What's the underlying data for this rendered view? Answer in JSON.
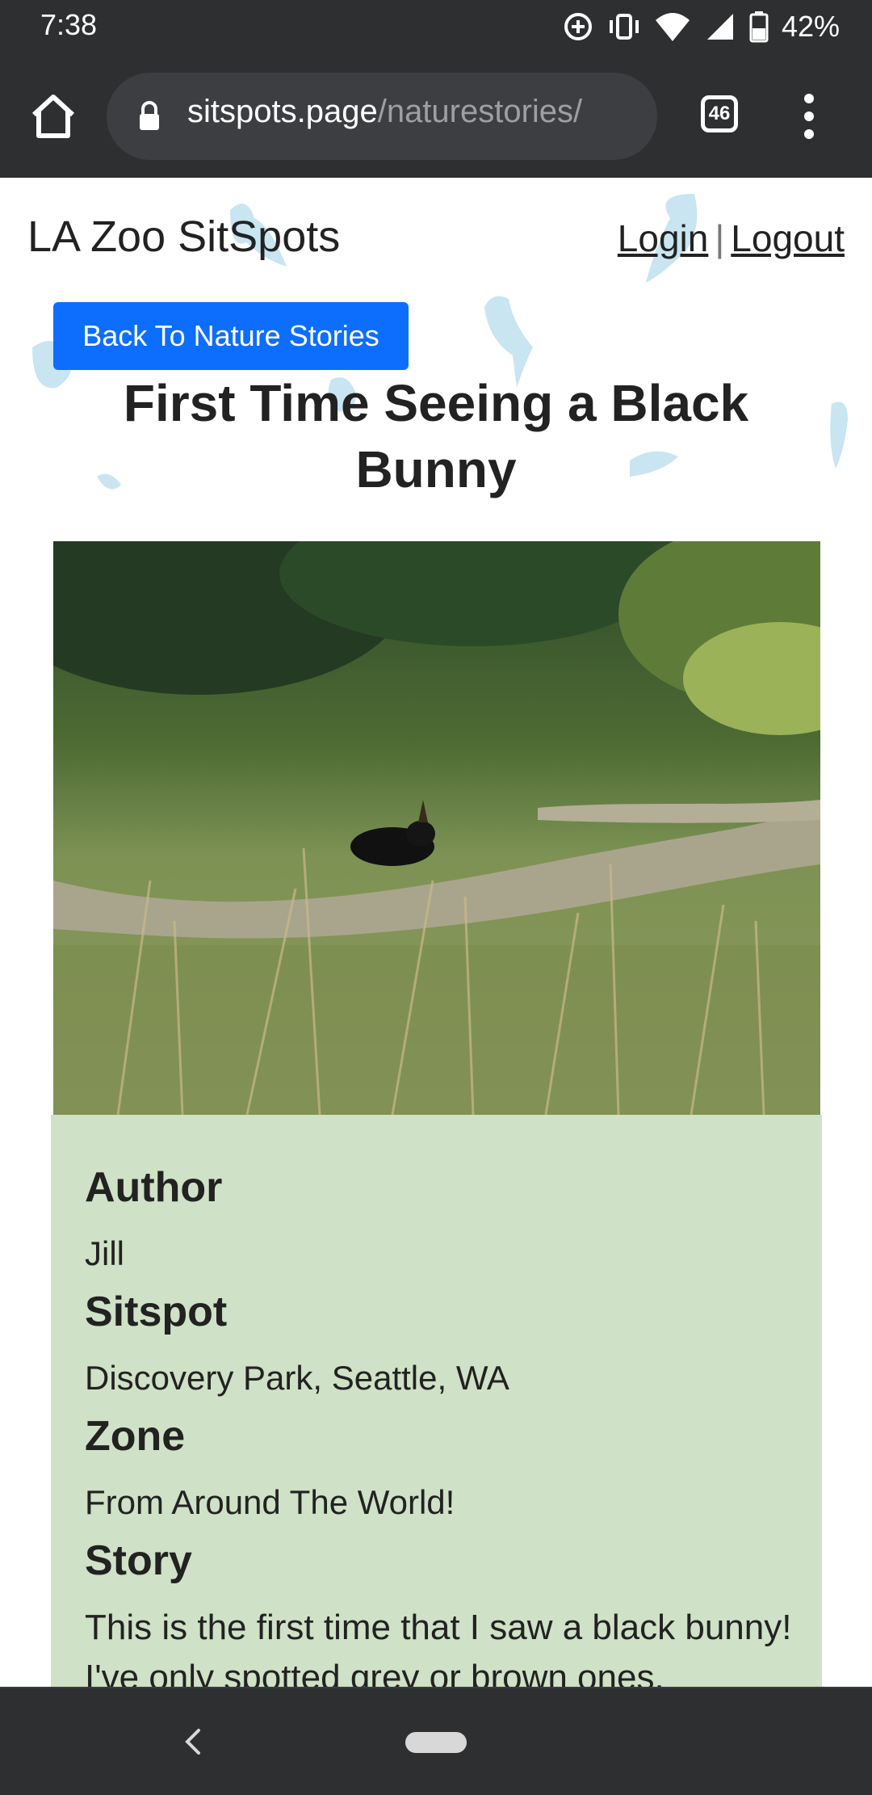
{
  "status_bar": {
    "time": "7:38",
    "battery": "42%",
    "icons": [
      "sync-icon",
      "vibrate-icon",
      "wifi-icon",
      "signal-icon",
      "battery-icon"
    ]
  },
  "browser": {
    "url_domain": "sitspots.page",
    "url_path": "/naturestories/",
    "tab_count": "46",
    "icons": [
      "home-icon",
      "lock-icon",
      "more-vert-icon"
    ]
  },
  "site": {
    "title": "LA Zoo SitSpots",
    "login": "Login",
    "separator": "|",
    "logout": "Logout"
  },
  "back_button": "Back To Nature Stories",
  "story": {
    "title": "First Time Seeing a Black Bunny",
    "author_label": "Author",
    "author": "Jill",
    "sitspot_label": "Sitspot",
    "sitspot": "Discovery Park, Seattle, WA",
    "zone_label": "Zone",
    "zone": "From Around The World!",
    "story_label": "Story",
    "story_text": "This is the first time that I saw a black bunny! I've only spotted grey or brown ones."
  },
  "colors": {
    "primary_button": "#0d6efd",
    "card_background": "#cfe1c6",
    "chrome": "#2e2f31"
  }
}
